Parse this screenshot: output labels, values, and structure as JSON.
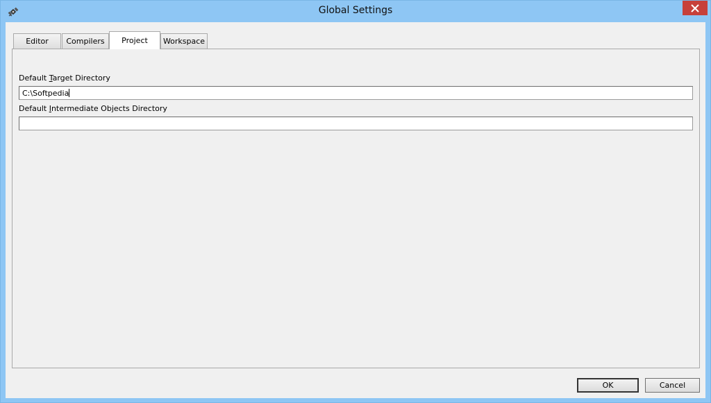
{
  "window": {
    "title": "Global Settings"
  },
  "tabs": [
    {
      "label": "Editor"
    },
    {
      "label": "Compilers"
    },
    {
      "label": "Project"
    },
    {
      "label": "Workspace"
    }
  ],
  "project": {
    "target_dir": {
      "label_pre": "Default ",
      "label_u": "T",
      "label_post": "arget Directory",
      "value": "C:\\Softpedia"
    },
    "intermediate_dir": {
      "label_pre": "Default ",
      "label_u": "I",
      "label_post": "ntermediate Objects Directory",
      "value": ""
    }
  },
  "buttons": {
    "ok": "OK",
    "cancel": "Cancel"
  },
  "icons": {
    "app": "satellite-icon",
    "close": "close-icon"
  },
  "colors": {
    "frame": "#8ec6f4",
    "close": "#c7403a"
  }
}
